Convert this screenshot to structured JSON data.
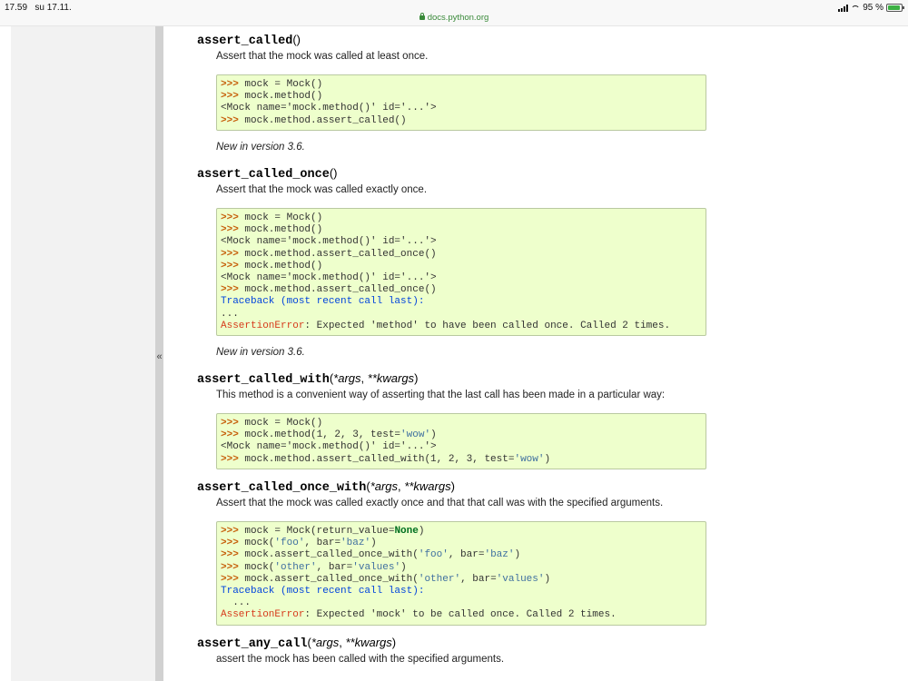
{
  "status": {
    "time": "17.59",
    "date": "su 17.11.",
    "url": "docs.python.org",
    "battery": "95 %",
    "battery_level": 0.95
  },
  "sidebar": {
    "collapse_glyph": "«"
  },
  "methods": [
    {
      "name": "assert_called",
      "paren_open": "(",
      "params": [],
      "paren_close": ")",
      "description": "Assert that the mock was called at least once.",
      "code": [
        [
          {
            "t": ">>> ",
            "c": "p"
          },
          {
            "t": "mock = Mock()"
          }
        ],
        [
          {
            "t": ">>> ",
            "c": "p"
          },
          {
            "t": "mock.method()"
          }
        ],
        [
          {
            "t": "<Mock name='mock.method()' id='...'>"
          }
        ],
        [
          {
            "t": ">>> ",
            "c": "p"
          },
          {
            "t": "mock.method.assert_called()"
          }
        ]
      ],
      "note": "New in version 3.6."
    },
    {
      "name": "assert_called_once",
      "paren_open": "(",
      "params": [],
      "paren_close": ")",
      "description": "Assert that the mock was called exactly once.",
      "code": [
        [
          {
            "t": ">>> ",
            "c": "p"
          },
          {
            "t": "mock = Mock()"
          }
        ],
        [
          {
            "t": ">>> ",
            "c": "p"
          },
          {
            "t": "mock.method()"
          }
        ],
        [
          {
            "t": "<Mock name='mock.method()' id='...'>"
          }
        ],
        [
          {
            "t": ">>> ",
            "c": "p"
          },
          {
            "t": "mock.method.assert_called_once()"
          }
        ],
        [
          {
            "t": ">>> ",
            "c": "p"
          },
          {
            "t": "mock.method()"
          }
        ],
        [
          {
            "t": "<Mock name='mock.method()' id='...'>"
          }
        ],
        [
          {
            "t": ">>> ",
            "c": "p"
          },
          {
            "t": "mock.method.assert_called_once()"
          }
        ],
        [
          {
            "t": "Traceback (most recent call last):",
            "c": "tb"
          }
        ],
        [
          {
            "t": "..."
          }
        ],
        [
          {
            "t": "AssertionError",
            "c": "err"
          },
          {
            "t": ": Expected 'method' to have been called once. Called 2 times."
          }
        ]
      ],
      "note": "New in version 3.6."
    },
    {
      "name": "assert_called_with",
      "paren_open": "(",
      "params": [
        "*args",
        "**kwargs"
      ],
      "paren_close": ")",
      "description": "This method is a convenient way of asserting that the last call has been made in a particular way:",
      "code": [
        [
          {
            "t": ">>> ",
            "c": "p"
          },
          {
            "t": "mock = Mock()"
          }
        ],
        [
          {
            "t": ">>> ",
            "c": "p"
          },
          {
            "t": "mock.method(1, 2, 3, test="
          },
          {
            "t": "'wow'",
            "c": "s"
          },
          {
            "t": ")"
          }
        ],
        [
          {
            "t": "<Mock name='mock.method()' id='...'>"
          }
        ],
        [
          {
            "t": ">>> ",
            "c": "p"
          },
          {
            "t": "mock.method.assert_called_with(1, 2, 3, test="
          },
          {
            "t": "'wow'",
            "c": "s"
          },
          {
            "t": ")"
          }
        ]
      ],
      "note": ""
    },
    {
      "name": "assert_called_once_with",
      "paren_open": "(",
      "params": [
        "*args",
        "**kwargs"
      ],
      "paren_close": ")",
      "description": "Assert that the mock was called exactly once and that that call was with the specified arguments.",
      "code": [
        [
          {
            "t": ">>> ",
            "c": "p"
          },
          {
            "t": "mock = Mock(return_value="
          },
          {
            "t": "None",
            "c": "kw"
          },
          {
            "t": ")"
          }
        ],
        [
          {
            "t": ">>> ",
            "c": "p"
          },
          {
            "t": "mock("
          },
          {
            "t": "'foo'",
            "c": "s"
          },
          {
            "t": ", bar="
          },
          {
            "t": "'baz'",
            "c": "s"
          },
          {
            "t": ")"
          }
        ],
        [
          {
            "t": ">>> ",
            "c": "p"
          },
          {
            "t": "mock.assert_called_once_with("
          },
          {
            "t": "'foo'",
            "c": "s"
          },
          {
            "t": ", bar="
          },
          {
            "t": "'baz'",
            "c": "s"
          },
          {
            "t": ")"
          }
        ],
        [
          {
            "t": ">>> ",
            "c": "p"
          },
          {
            "t": "mock("
          },
          {
            "t": "'other'",
            "c": "s"
          },
          {
            "t": ", bar="
          },
          {
            "t": "'values'",
            "c": "s"
          },
          {
            "t": ")"
          }
        ],
        [
          {
            "t": ">>> ",
            "c": "p"
          },
          {
            "t": "mock.assert_called_once_with("
          },
          {
            "t": "'other'",
            "c": "s"
          },
          {
            "t": ", bar="
          },
          {
            "t": "'values'",
            "c": "s"
          },
          {
            "t": ")"
          }
        ],
        [
          {
            "t": "Traceback (most recent call last):",
            "c": "tb"
          }
        ],
        [
          {
            "t": "  ..."
          }
        ],
        [
          {
            "t": "AssertionError",
            "c": "err"
          },
          {
            "t": ": Expected 'mock' to be called once. Called 2 times."
          }
        ]
      ],
      "note": ""
    },
    {
      "name": "assert_any_call",
      "paren_open": "(",
      "params": [
        "*args",
        "**kwargs"
      ],
      "paren_close": ")",
      "description": "assert the mock has been called with the specified arguments.",
      "code": [],
      "note": ""
    }
  ]
}
